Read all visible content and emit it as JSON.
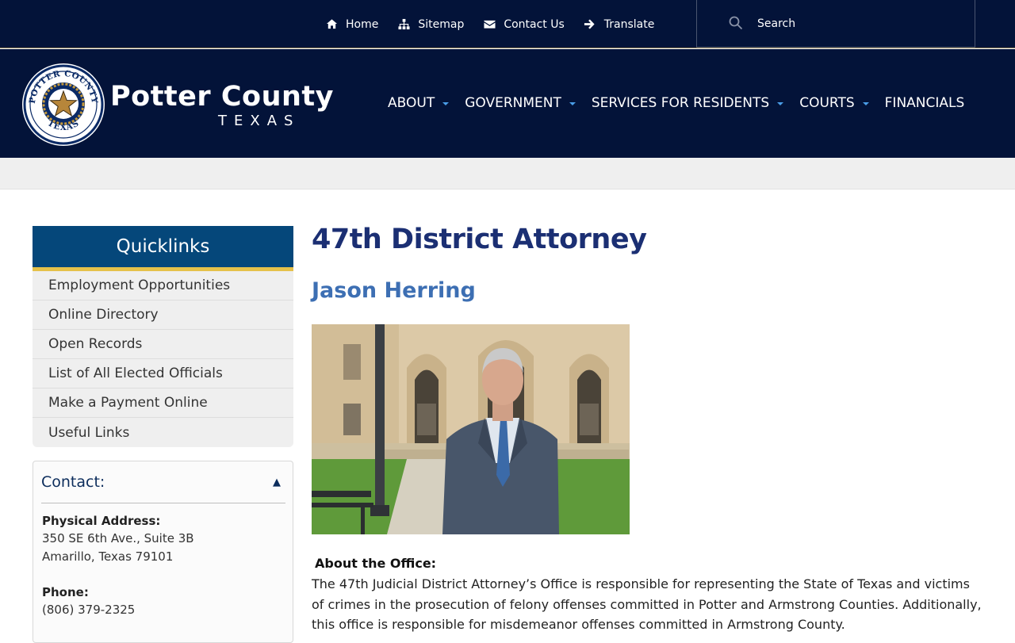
{
  "topbar": {
    "links": [
      {
        "label": "Home",
        "icon": "home-icon"
      },
      {
        "label": "Sitemap",
        "icon": "sitemap-icon"
      },
      {
        "label": "Contact Us",
        "icon": "envelope-icon"
      },
      {
        "label": "Translate",
        "icon": "arrow-right-icon"
      }
    ],
    "search_placeholder": "Search"
  },
  "header": {
    "brand_title": "Potter County",
    "brand_subtitle": "TEXAS",
    "seal_top_text": "POTTER COUNTY",
    "seal_bottom_text": "TEXAS",
    "nav": [
      {
        "label": "ABOUT",
        "has_dropdown": true
      },
      {
        "label": "GOVERNMENT",
        "has_dropdown": true
      },
      {
        "label": "SERVICES FOR RESIDENTS",
        "has_dropdown": true
      },
      {
        "label": "COURTS",
        "has_dropdown": true
      },
      {
        "label": "FINANCIALS",
        "has_dropdown": false
      }
    ]
  },
  "sidebar": {
    "quicklinks_title": "Quicklinks",
    "quicklinks": [
      "Employment Opportunities",
      "Online Directory",
      "Open Records",
      "List of All Elected Officials",
      "Make a Payment Online",
      "Useful Links"
    ],
    "contact": {
      "title": "Contact:",
      "toggle": "▲",
      "physical_label": "Physical Address:",
      "address_line1": "350 SE 6th Ave., Suite 3B",
      "address_line2": "Amarillo, Texas 79101",
      "phone_label": "Phone:",
      "phone": "(806) 379-2325"
    }
  },
  "main": {
    "title": "47th District Attorney",
    "subtitle": "Jason Herring",
    "about_heading": "About the Office:",
    "about_text": "The 47th Judicial District Attorney’s Office is responsible for representing the State of Texas and victims of crimes in the prosecution of felony offenses committed in Potter and Armstrong Counties.  Additionally, this office is responsible for misdemeanor offenses committed in Armstrong County."
  },
  "colors": {
    "navy": "#031339",
    "title_blue": "#1b2f73",
    "subtitle_blue": "#3d6fb3",
    "quicklinks_blue": "#05477a",
    "gold": "#e5c14a"
  }
}
